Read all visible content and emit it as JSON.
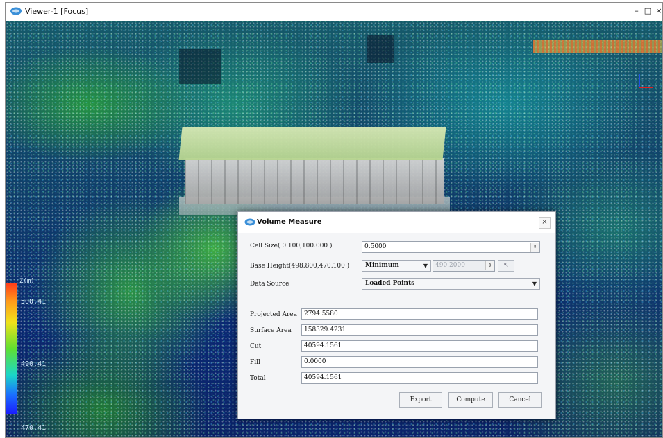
{
  "window": {
    "title": "Viewer-1 [Focus]",
    "minimize": "–",
    "maximize": "□",
    "close": "×"
  },
  "color_scale": {
    "title": "Z(m)",
    "max": "500.41",
    "mid": "490.41",
    "min": "470.41"
  },
  "dialog": {
    "title": "Volume Measure",
    "close": "×",
    "cell_size_label": "Cell Size( 0.100,100.000 )",
    "cell_size_value": "0.5000",
    "base_height_label": "Base Height(498.800,470.100 )",
    "base_height_mode": "Minimum",
    "base_height_value": "490.2000",
    "data_source_label": "Data Source",
    "data_source_value": "Loaded Points",
    "projected_area_label": "Projected Area",
    "projected_area_value": "2794.5580",
    "surface_area_label": "Surface Area",
    "surface_area_value": "158329.4231",
    "cut_label": "Cut",
    "cut_value": "40594.1561",
    "fill_label": "Fill",
    "fill_value": "0.0000",
    "total_label": "Total",
    "total_value": "40594.1561",
    "buttons": {
      "export": "Export",
      "compute": "Compute",
      "cancel": "Cancel"
    }
  }
}
